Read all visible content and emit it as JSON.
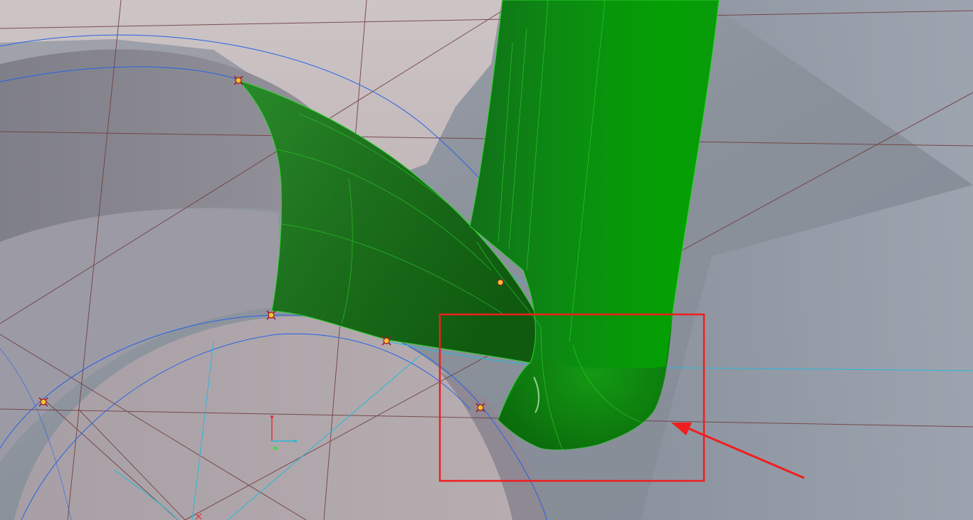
{
  "viewport": {
    "name": "cad-3d-viewport",
    "colors": {
      "background": "#8e949c",
      "housing_surface": "#a59ea5",
      "light_surface": "#c8bfc1",
      "selected_face": "#1f8a1f",
      "selected_face_bright": "#04a004",
      "selected_edge": "#2dd22d",
      "sketch_line": "#6e3a3a",
      "construction_arc": "#2563e6",
      "cyan_curve": "#27b9d9",
      "highlight_box": "#f01e1e"
    }
  },
  "annotation": {
    "box_shape": "rectangle",
    "arrow_shape": "arrow"
  },
  "icons": {
    "point": "sketch-point-icon",
    "triad": "coordinate-triad-icon"
  }
}
